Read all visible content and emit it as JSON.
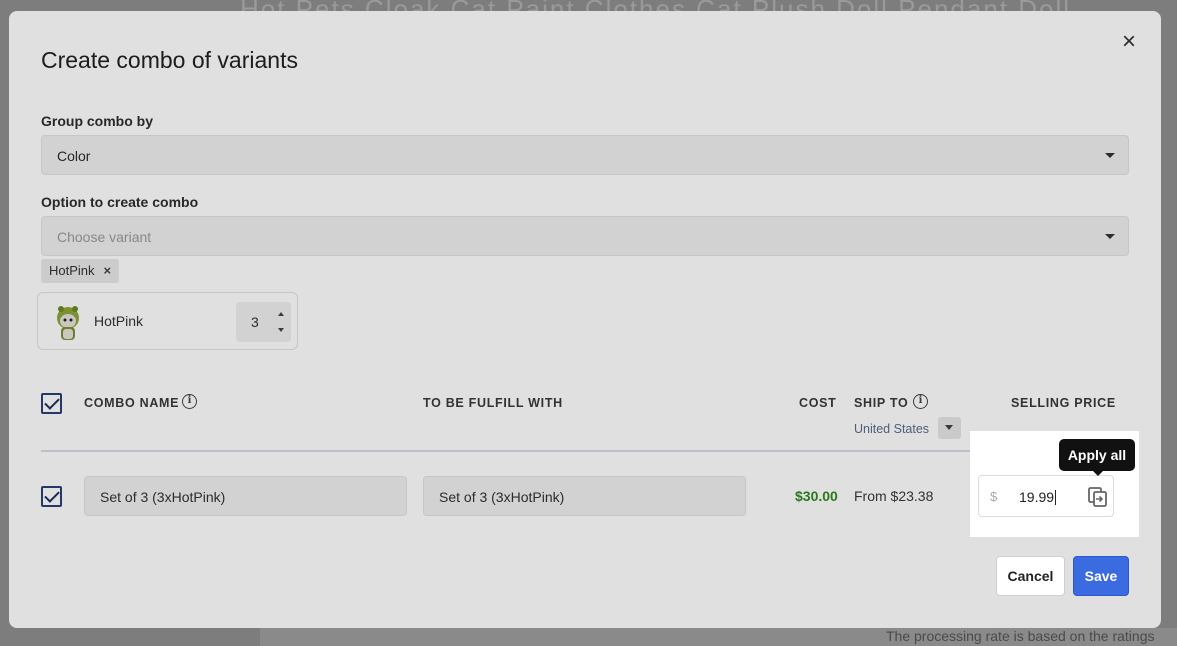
{
  "background": {
    "title_fragment": "Hot Pets Cloak Cat Paint Clothes Cat Plush Doll Pendant Doll",
    "footer_note": "The processing rate is based on the ratings"
  },
  "modal": {
    "title": "Create combo of variants",
    "close_icon": "close-icon"
  },
  "group_combo": {
    "label": "Group combo by",
    "value": "Color"
  },
  "combo_option": {
    "label": "Option to create combo",
    "placeholder": "Choose variant",
    "selected_tags": [
      "HotPink"
    ]
  },
  "variant_card": {
    "name": "HotPink",
    "quantity": "3"
  },
  "table": {
    "headers": {
      "combo_name": "COMBO NAME",
      "fulfill_with": "TO BE FULFILL WITH",
      "cost": "COST",
      "ship_to": "SHIP TO",
      "selling_price": "SELLING PRICE"
    },
    "ship_to_country": "United States",
    "rows": [
      {
        "checked": true,
        "combo_name": "Set of 3 (3xHotPink)",
        "fulfill_with": "Set of 3 (3xHotPink)",
        "cost": "$30.00",
        "ship_price": "From $23.38",
        "currency": "$",
        "selling_price": "19.99"
      }
    ]
  },
  "tooltip": {
    "text": "Apply all"
  },
  "footer": {
    "cancel_label": "Cancel",
    "save_label": "Save"
  },
  "colors": {
    "cost_green": "#2f8a1f",
    "save_blue": "#3b6be0",
    "checkbox_navy": "#2a3f7a"
  }
}
